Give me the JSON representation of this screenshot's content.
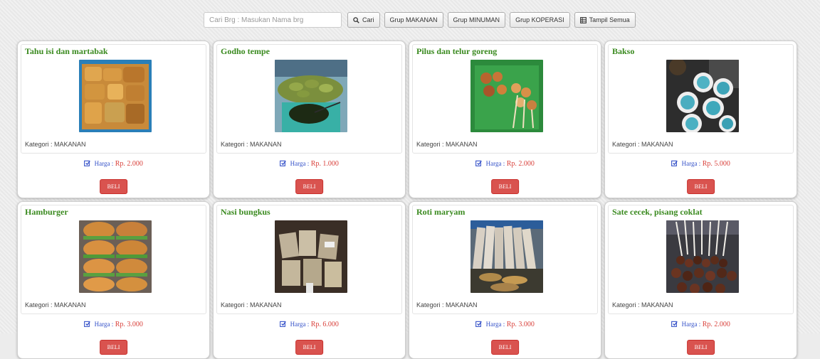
{
  "toolbar": {
    "search_placeholder": "Cari Brg : Masukan Nama brg",
    "search_button": "Cari",
    "group_buttons": [
      "Grup MAKANAN",
      "Grup MINUMAN",
      "Grup KOPERASI"
    ],
    "show_all_button": "Tampil Semua",
    "search_icon": "search-icon",
    "show_all_icon": "list-icon"
  },
  "products": [
    {
      "name": "Tahu isi dan martabak",
      "category_label": "Kategori : MAKANAN",
      "price_label": "Harga :",
      "price": "Rp. 2.000",
      "buy_label": "BELI"
    },
    {
      "name": "Godho tempe",
      "category_label": "Kategori : MAKANAN",
      "price_label": "Harga :",
      "price": "Rp. 1.000",
      "buy_label": "BELI"
    },
    {
      "name": "Pilus dan telur goreng",
      "category_label": "Kategori : MAKANAN",
      "price_label": "Harga :",
      "price": "Rp. 2.000",
      "buy_label": "BELI"
    },
    {
      "name": "Bakso",
      "category_label": "Kategori : MAKANAN",
      "price_label": "Harga :",
      "price": "Rp. 5.000",
      "buy_label": "BELI"
    },
    {
      "name": "Hamburger",
      "category_label": "Kategori : MAKANAN",
      "price_label": "Harga :",
      "price": "Rp. 3.000",
      "buy_label": "BELI"
    },
    {
      "name": "Nasi bungkus",
      "category_label": "Kategori : MAKANAN",
      "price_label": "Harga :",
      "price": "Rp. 6.000",
      "buy_label": "BELI"
    },
    {
      "name": "Roti maryam",
      "category_label": "Kategori : MAKANAN",
      "price_label": "Harga :",
      "price": "Rp. 3.000",
      "buy_label": "BELI"
    },
    {
      "name": "Sate cecek, pisang coklat",
      "category_label": "Kategori : MAKANAN",
      "price_label": "Harga :",
      "price": "Rp. 2.000",
      "buy_label": "BELI"
    }
  ],
  "colors": {
    "title": "#3a8a1f",
    "price_label": "#3350c8",
    "price_value": "#d9413b",
    "buy_button": "#d9534f"
  }
}
